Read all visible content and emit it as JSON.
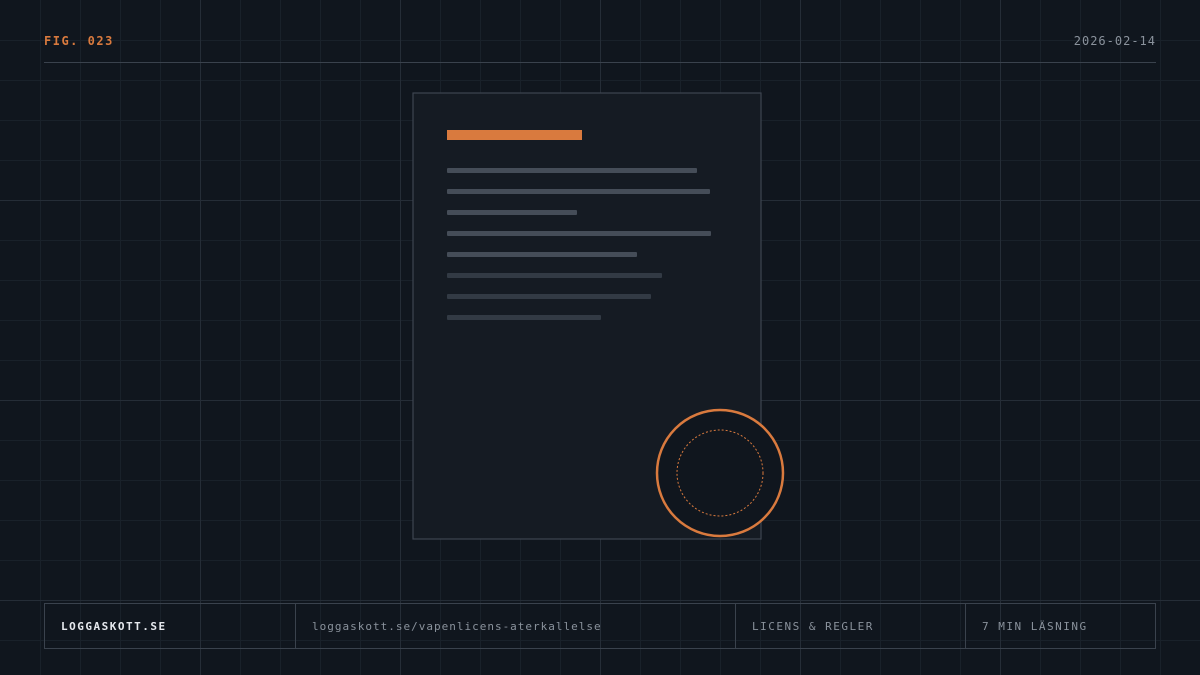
{
  "header": {
    "figure_label": "FIG. 023",
    "date": "2026-02-14"
  },
  "footer": {
    "site": "LOGGASKOTT.SE",
    "url": "loggaskott.se/vapenlicens-aterkallelse",
    "category": "LICENS & REGLER",
    "reading_time": "7 MIN LÄSNING"
  },
  "illustration": {
    "icons": [
      "document-icon",
      "stamp-icon"
    ],
    "colors": {
      "accent": "#d97a3e",
      "background": "#10161e",
      "paper": "#151b23",
      "text_lines": "#454d58",
      "grid": "#1c232c"
    }
  }
}
